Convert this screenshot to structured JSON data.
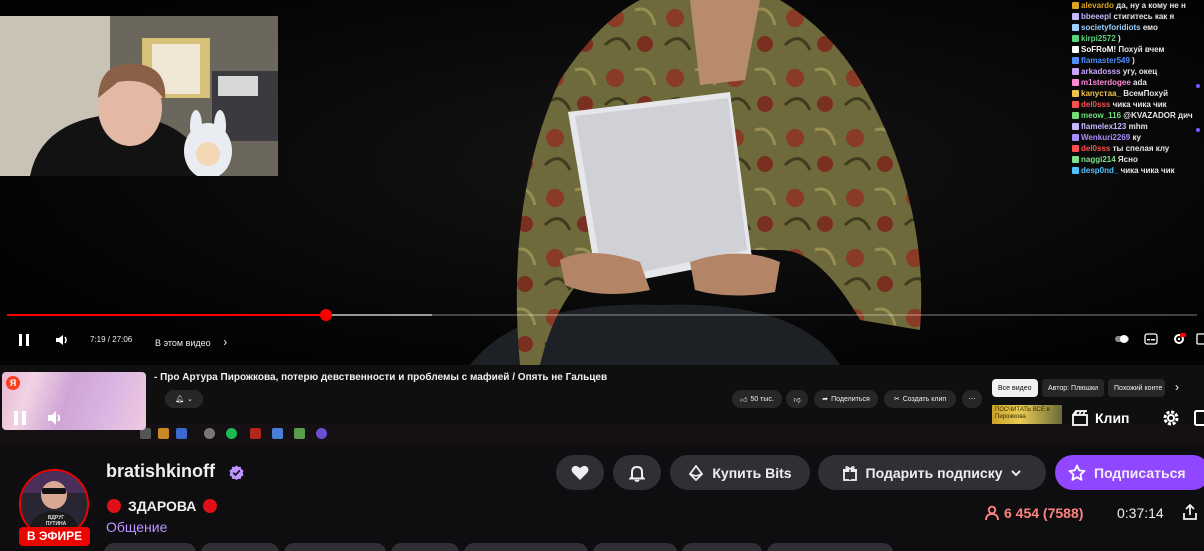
{
  "chat": {
    "lines": [
      {
        "user": "alevardo",
        "color": "#daa520",
        "msg": "да, ну а кому не н"
      },
      {
        "user": "bbeeepl",
        "color": "#c7b7ff",
        "msg": "стигитесь как я"
      },
      {
        "user": "societyforidiots",
        "color": "#9ad1ff",
        "msg": "емо"
      },
      {
        "user": "kirpi2572",
        "color": "#57d67a",
        "msg": ")"
      },
      {
        "user": "SoFRoM!",
        "color": "#ffffff",
        "msg": "Похуй вчем"
      },
      {
        "user": "flamaster549",
        "color": "#4f8dff",
        "msg": ")"
      },
      {
        "user": "arkadosss",
        "color": "#c8a6ff",
        "msg": "угу, окец"
      },
      {
        "user": "m1sterdogee",
        "color": "#ff8ad8",
        "msg": "ada"
      },
      {
        "user": "kanycтaa_",
        "color": "#f0c24b",
        "msg": "ВсемПохуй"
      },
      {
        "user": "del0sss",
        "color": "#ff4f4f",
        "msg": "чика чика чик"
      },
      {
        "user": "meow_116",
        "color": "#6fe07a",
        "msg": "@KVAZADOR дич"
      },
      {
        "user": "flamelex123",
        "color": "#c7b7ff",
        "msg": "mhm"
      },
      {
        "user": "Wenkuri2269",
        "color": "#a98bff",
        "msg": "ку"
      },
      {
        "user": "del0sss",
        "color": "#ff4f4f",
        "msg": "ты спелая клу"
      },
      {
        "user": "naggi214",
        "color": "#7ee08a",
        "msg": "Ясно"
      },
      {
        "user": "desp0nd_",
        "color": "#4fc3ff",
        "msg": "чика чика чик"
      }
    ]
  },
  "yt": {
    "progress_percent": 26.8,
    "time": "7:19 / 27:06",
    "chapter": "В этом видео",
    "title": "- Про Артура Пирожкова, потерю девственности и проблемы с мафией / Опять не Гальцев",
    "likes": "50 тыс.",
    "share_label": "Поделиться",
    "clip_label": "Создать клип",
    "chips": [
      "Все видео",
      "Автор: Плюшки",
      "Похожий конте"
    ],
    "thumb_text": "ПОСЧИТАТЬ ВСЁ в Пирожкова"
  },
  "twitch": {
    "clip_label": "Клип",
    "channel": {
      "name": "bratishkinoff",
      "title": "ЗДАРОВА",
      "category": "Общение",
      "live_label": "В ЭФИРЕ",
      "avatar_text": "ВДРУГ ПУТИНА"
    },
    "buttons": {
      "bits": "Купить Bits",
      "gift": "Подарить подписку",
      "subscribe": "Подписаться"
    },
    "viewers": "6 454 (7588)",
    "uptime": "0:37:14"
  },
  "colors": {
    "accent": "#9147ff",
    "live": "#eb0400",
    "viewers": "#ff8280",
    "category": "#bf94ff",
    "yt_red": "#ff0000"
  }
}
